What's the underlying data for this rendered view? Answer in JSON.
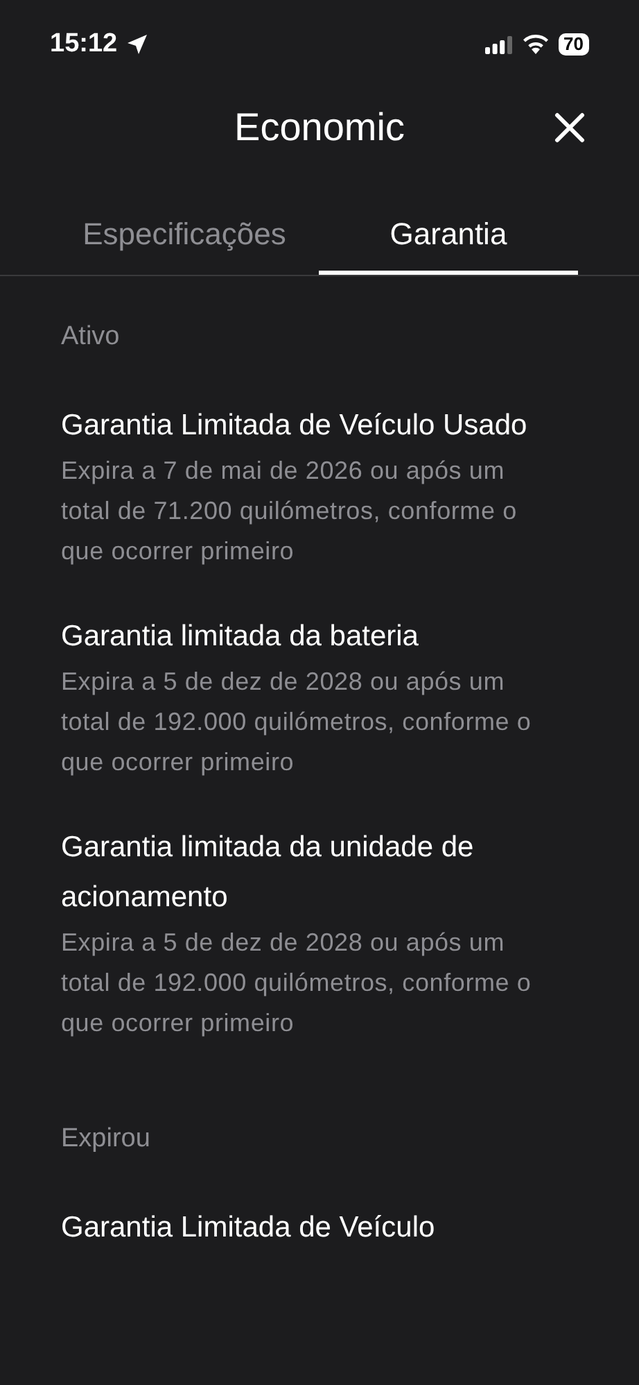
{
  "status_bar": {
    "time": "15:12",
    "battery": "70"
  },
  "header": {
    "title": "Economic"
  },
  "tabs": [
    {
      "label": "Especificações",
      "selected": false
    },
    {
      "label": "Garantia",
      "selected": true
    }
  ],
  "sections": [
    {
      "heading": "Ativo",
      "items": [
        {
          "title": "Garantia Limitada de Veículo Usado",
          "description": "Expira a 7 de mai de 2026 ou após um total de 71.200 quilómetros, conforme o que ocorrer primeiro"
        },
        {
          "title": "Garantia limitada da bateria",
          "description": "Expira a 5 de dez de 2028 ou após um total de 192.000 quilómetros, conforme o que ocorrer primeiro"
        },
        {
          "title": "Garantia limitada da unidade de acionamento",
          "description": "Expira a 5 de dez de 2028 ou após um total de 192.000 quilómetros, conforme o que ocorrer primeiro"
        }
      ]
    },
    {
      "heading": "Expirou",
      "items": [
        {
          "title": "Garantia Limitada de Veículo"
        }
      ]
    }
  ]
}
